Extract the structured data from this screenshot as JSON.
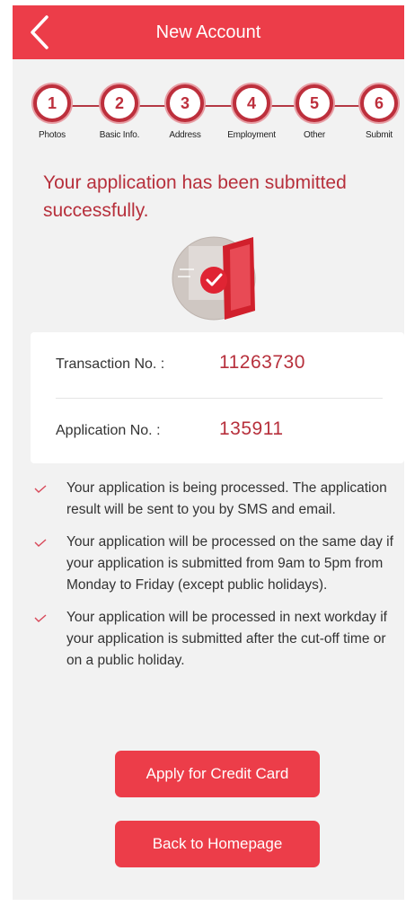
{
  "header": {
    "title": "New Account"
  },
  "stepper": {
    "steps": [
      {
        "number": "1",
        "label": "Photos"
      },
      {
        "number": "2",
        "label": "Basic Info."
      },
      {
        "number": "3",
        "label": "Address"
      },
      {
        "number": "4",
        "label": "Employment"
      },
      {
        "number": "5",
        "label": "Other"
      },
      {
        "number": "6",
        "label": "Submit"
      }
    ]
  },
  "success": {
    "title": "Your application has been submitted successfully."
  },
  "details": {
    "transaction_label": "Transaction No. :",
    "transaction_value": "11263730",
    "application_label": "Application No. :",
    "application_value": "135911"
  },
  "notes": [
    "Your application is being processed. The application result will be sent to you by SMS and email.",
    "Your application will be processed on the same day if your application is submitted from 9am to 5pm from Monday to Friday (except public holidays).",
    "Your application will be processed in next workday if your application is submitted after the cut-off time or on a public holiday."
  ],
  "actions": {
    "apply_credit_card": "Apply for Credit Card",
    "back_homepage": "Back to Homepage"
  },
  "colors": {
    "brand_red": "#ec3d49",
    "text_red": "#b7303c"
  },
  "icons": {
    "back": "chevron-left-icon",
    "success": "submitted-document-check-icon",
    "note": "check-icon"
  }
}
